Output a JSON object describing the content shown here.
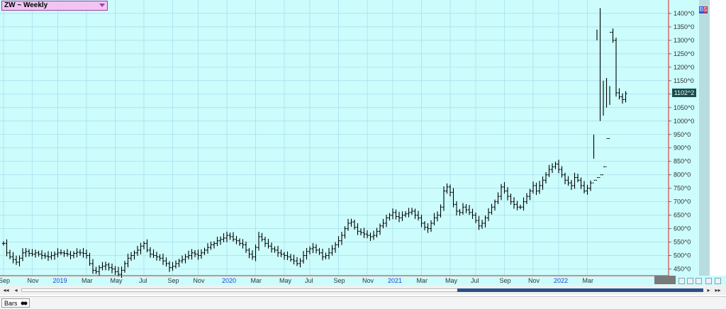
{
  "symbol_label": "ZW ~ Weekly",
  "badge": {
    "b": "B",
    "s": "S"
  },
  "last_price_label": "1102^2",
  "bottom_tab_label": "Bars",
  "colors": {
    "plot_bg": "#ccfcfc",
    "grid": "#9ed8e8",
    "axis_line": "#d42020",
    "bars": "#000000",
    "year_labels": "#2244cc",
    "month_labels": "#333333"
  },
  "chart_data": {
    "type": "ohlc",
    "title": "ZW ~ Weekly",
    "ylim": [
      425,
      1450
    ],
    "grid": true,
    "y_ticks": [
      {
        "value": 450,
        "label": "450^0"
      },
      {
        "value": 500,
        "label": "500^0"
      },
      {
        "value": 550,
        "label": "550^0"
      },
      {
        "value": 600,
        "label": "600^0"
      },
      {
        "value": 650,
        "label": "650^0"
      },
      {
        "value": 700,
        "label": "700^0"
      },
      {
        "value": 750,
        "label": "750^0"
      },
      {
        "value": 800,
        "label": "800^0"
      },
      {
        "value": 850,
        "label": "850^0"
      },
      {
        "value": 900,
        "label": "900^0"
      },
      {
        "value": 950,
        "label": "950^0"
      },
      {
        "value": 1000,
        "label": "1000^0"
      },
      {
        "value": 1050,
        "label": "1050^0"
      },
      {
        "value": 1100,
        "label": "1100^0"
      },
      {
        "value": 1150,
        "label": "1150^0"
      },
      {
        "value": 1200,
        "label": "1200^0"
      },
      {
        "value": 1250,
        "label": "1250^0"
      },
      {
        "value": 1300,
        "label": "1300^0"
      },
      {
        "value": 1350,
        "label": "1350^0"
      },
      {
        "value": 1400,
        "label": "1400^0"
      }
    ],
    "x_ticks": [
      {
        "week": 0,
        "label": "Sep",
        "year": false
      },
      {
        "week": 9,
        "label": "Nov",
        "year": false
      },
      {
        "week": 17,
        "label": "2019",
        "year": true
      },
      {
        "week": 26,
        "label": "Mar",
        "year": false
      },
      {
        "week": 35,
        "label": "May",
        "year": false
      },
      {
        "week": 44,
        "label": "Jul",
        "year": false
      },
      {
        "week": 53,
        "label": "Sep",
        "year": false
      },
      {
        "week": 61,
        "label": "Nov",
        "year": false
      },
      {
        "week": 70,
        "label": "2020",
        "year": true
      },
      {
        "week": 79,
        "label": "Mar",
        "year": false
      },
      {
        "week": 88,
        "label": "May",
        "year": false
      },
      {
        "week": 96,
        "label": "Jul",
        "year": false
      },
      {
        "week": 105,
        "label": "Sep",
        "year": false
      },
      {
        "week": 114,
        "label": "Nov",
        "year": false
      },
      {
        "week": 122,
        "label": "2021",
        "year": true
      },
      {
        "week": 131,
        "label": "Mar",
        "year": false
      },
      {
        "week": 140,
        "label": "May",
        "year": false
      },
      {
        "week": 148,
        "label": "Jul",
        "year": false
      },
      {
        "week": 157,
        "label": "Sep",
        "year": false
      },
      {
        "week": 166,
        "label": "Nov",
        "year": false
      },
      {
        "week": 174,
        "label": "2022",
        "year": true
      },
      {
        "week": 183,
        "label": "Mar",
        "year": false
      }
    ],
    "close_series": [
      545,
      510,
      495,
      485,
      475,
      490,
      510,
      515,
      508,
      505,
      510,
      505,
      500,
      498,
      495,
      500,
      505,
      510,
      510,
      508,
      505,
      500,
      508,
      512,
      510,
      508,
      500,
      470,
      445,
      440,
      455,
      460,
      465,
      455,
      450,
      440,
      430,
      445,
      470,
      490,
      500,
      510,
      520,
      535,
      545,
      520,
      505,
      500,
      495,
      490,
      480,
      470,
      455,
      460,
      470,
      480,
      485,
      495,
      500,
      510,
      505,
      500,
      510,
      520,
      530,
      540,
      545,
      555,
      560,
      565,
      575,
      570,
      560,
      555,
      545,
      540,
      520,
      505,
      495,
      530,
      570,
      560,
      545,
      535,
      525,
      520,
      510,
      505,
      500,
      495,
      485,
      480,
      470,
      480,
      500,
      515,
      525,
      530,
      520,
      510,
      495,
      500,
      510,
      525,
      540,
      555,
      575,
      600,
      620,
      625,
      605,
      590,
      585,
      580,
      575,
      570,
      575,
      590,
      610,
      620,
      640,
      650,
      660,
      645,
      640,
      650,
      655,
      660,
      665,
      650,
      640,
      620,
      605,
      600,
      620,
      640,
      650,
      680,
      740,
      755,
      735,
      690,
      665,
      660,
      680,
      670,
      660,
      650,
      630,
      610,
      620,
      640,
      660,
      680,
      700,
      720,
      755,
      740,
      720,
      700,
      690,
      680,
      680,
      700,
      720,
      740,
      760,
      740,
      760,
      780,
      800,
      820,
      830,
      840,
      820,
      800,
      780,
      770,
      760,
      790,
      780,
      760,
      740,
      750,
      770,
      780,
      790,
      800,
      830,
      935,
      1330,
      1300,
      1105,
      1090,
      1080,
      1102
    ],
    "spike_bars": [
      {
        "week": 185,
        "low": 860,
        "high": 950
      },
      {
        "week": 186,
        "low": 1300,
        "high": 1340
      },
      {
        "week": 187,
        "low": 1000,
        "high": 1420
      },
      {
        "week": 188,
        "low": 1020,
        "high": 1150
      },
      {
        "week": 189,
        "low": 1050,
        "high": 1160
      },
      {
        "week": 190,
        "low": 1060,
        "high": 1130
      }
    ],
    "last_price": 1102.25
  }
}
